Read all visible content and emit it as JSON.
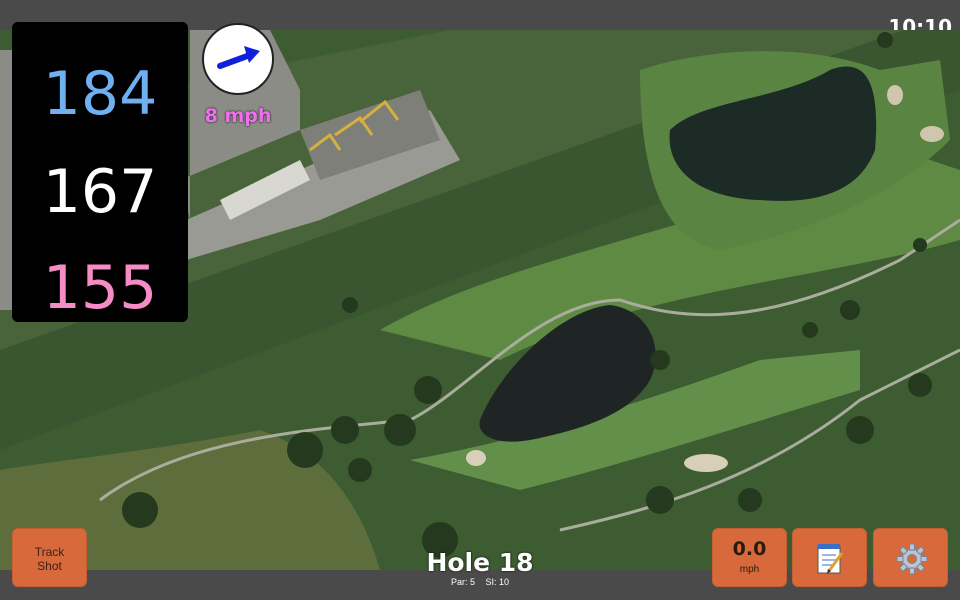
{
  "status_bar": {
    "time": "10:10"
  },
  "distances": {
    "back": "184",
    "middle": "167",
    "front": "155"
  },
  "colors": {
    "back": "#6fb0f1",
    "middle": "#ffffff",
    "front": "#f58cc6",
    "wind_arrow": "#1020d8",
    "wind_label": "#ef6ff0",
    "button": "#d7693a"
  },
  "wind": {
    "label": "8 mph",
    "direction_icon": "arrow-east-northeast-icon"
  },
  "buttons": {
    "track_shot": {
      "line1": "Track",
      "line2": "Shot"
    },
    "wind_speed": {
      "value": "0.0",
      "unit": "mph"
    },
    "notes": {
      "icon": "notepad-icon"
    },
    "settings": {
      "icon": "gear-icon"
    }
  },
  "hole": {
    "title": "Hole 18",
    "par": "Par: 5",
    "stroke_index": "SI: 10"
  }
}
